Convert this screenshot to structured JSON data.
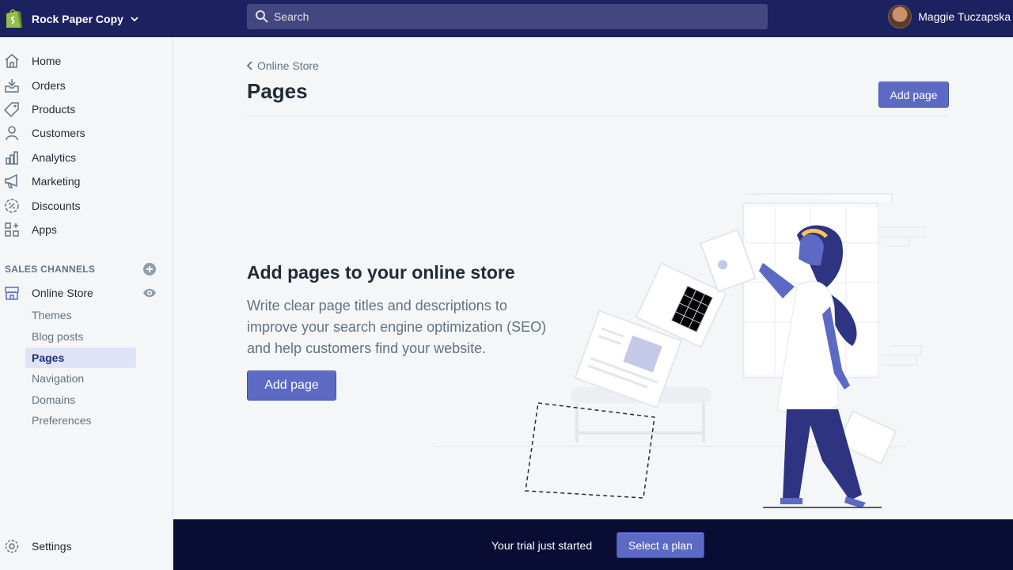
{
  "header": {
    "store_name": "Rock Paper Copy",
    "search_placeholder": "Search",
    "user_name": "Maggie Tuczapska"
  },
  "sidebar": {
    "items": [
      {
        "label": "Home",
        "icon": "home-icon"
      },
      {
        "label": "Orders",
        "icon": "orders-icon"
      },
      {
        "label": "Products",
        "icon": "tag-icon"
      },
      {
        "label": "Customers",
        "icon": "person-icon"
      },
      {
        "label": "Analytics",
        "icon": "bar-chart-icon"
      },
      {
        "label": "Marketing",
        "icon": "megaphone-icon"
      },
      {
        "label": "Discounts",
        "icon": "discount-icon"
      },
      {
        "label": "Apps",
        "icon": "apps-icon"
      }
    ],
    "sales_channels_heading": "SALES CHANNELS",
    "online_store": {
      "label": "Online Store",
      "subitems": [
        "Themes",
        "Blog posts",
        "Pages",
        "Navigation",
        "Domains",
        "Preferences"
      ],
      "active": "Pages"
    },
    "settings_label": "Settings"
  },
  "main": {
    "breadcrumb": "Online Store",
    "title": "Pages",
    "add_button": "Add page",
    "empty_state": {
      "heading": "Add pages to your online store",
      "description": "Write clear page titles and descriptions to improve your search engine optimization (SEO) and help customers find your website.",
      "button": "Add page"
    }
  },
  "trial": {
    "text": "Your trial just started",
    "button": "Select a plan"
  },
  "colors": {
    "topbar": "#1c2260",
    "accent": "#5c6ac4",
    "trial_bar": "#0a0d33",
    "active_nav": "#dfe3f6"
  }
}
